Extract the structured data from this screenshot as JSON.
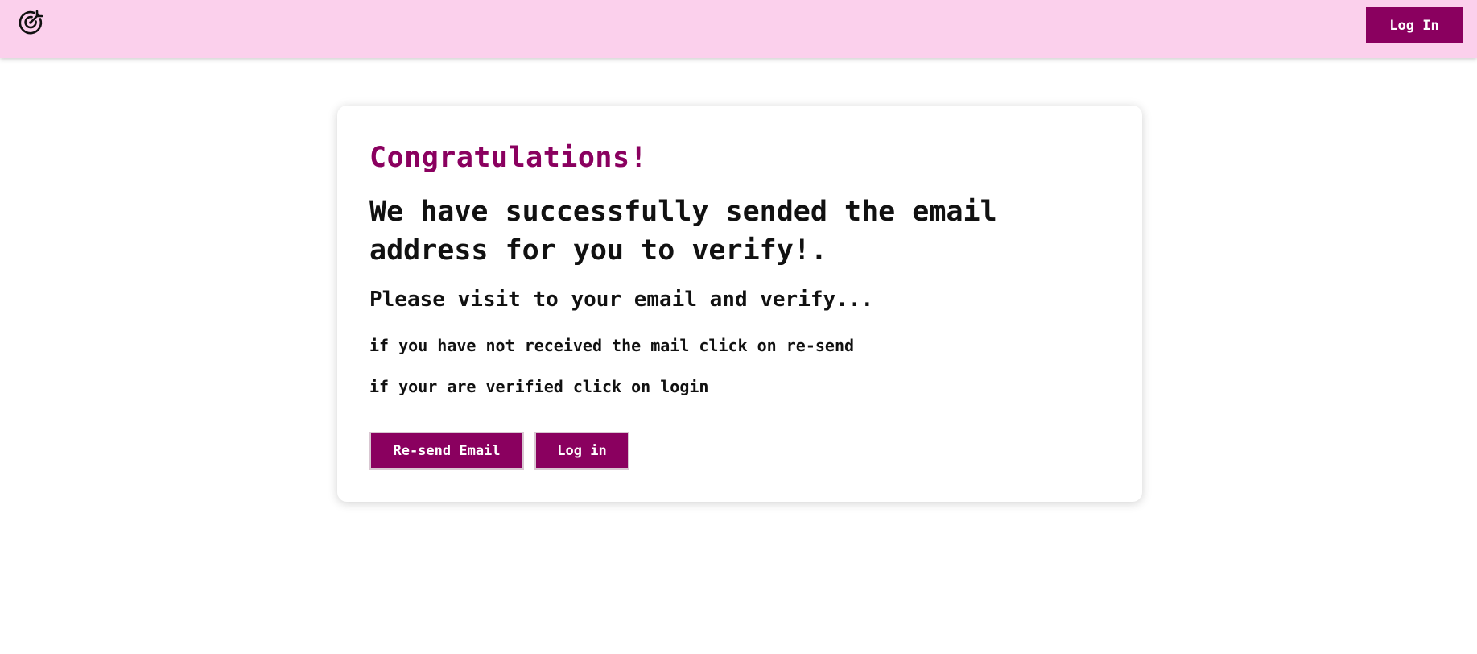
{
  "header": {
    "logo_icon": "target-arrow-icon",
    "login_label": "Log In",
    "background_color": "#fbd0ec",
    "accent_color": "#8a005f"
  },
  "card": {
    "heading": "Congratulations!",
    "subheading": "We have successfully sended the email address for you to verify!.",
    "instruction": "Please visit to your email and verify...",
    "hint_resend": "if you have not received the mail click on re-send",
    "hint_login": "if your are verified click on login",
    "resend_button_label": "Re-send Email",
    "login_button_label": "Log in"
  }
}
